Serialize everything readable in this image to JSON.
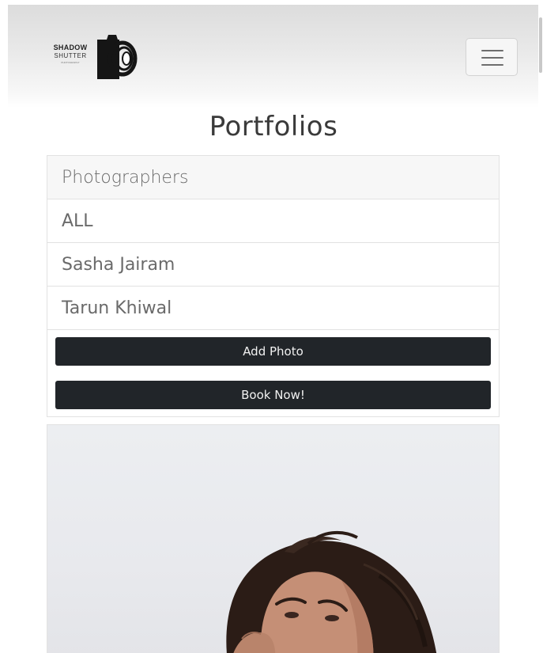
{
  "navbar": {
    "brand": {
      "line1": "SHADOW",
      "line2": "SHUTTER",
      "line3": "PHOTOGRAPHY"
    },
    "toggle_icon": "hamburger-icon"
  },
  "page": {
    "title": "Portfolios"
  },
  "list": {
    "header": "Photographers",
    "items": [
      {
        "label": "ALL"
      },
      {
        "label": "Sasha Jairam"
      },
      {
        "label": "Tarun Khiwal"
      }
    ],
    "buttons": {
      "add_photo": "Add Photo",
      "book_now": "Book Now!"
    }
  },
  "colors": {
    "button_dark": "#212529",
    "list_text": "#6a6a6a",
    "header_bg": "#f7f7f7"
  }
}
